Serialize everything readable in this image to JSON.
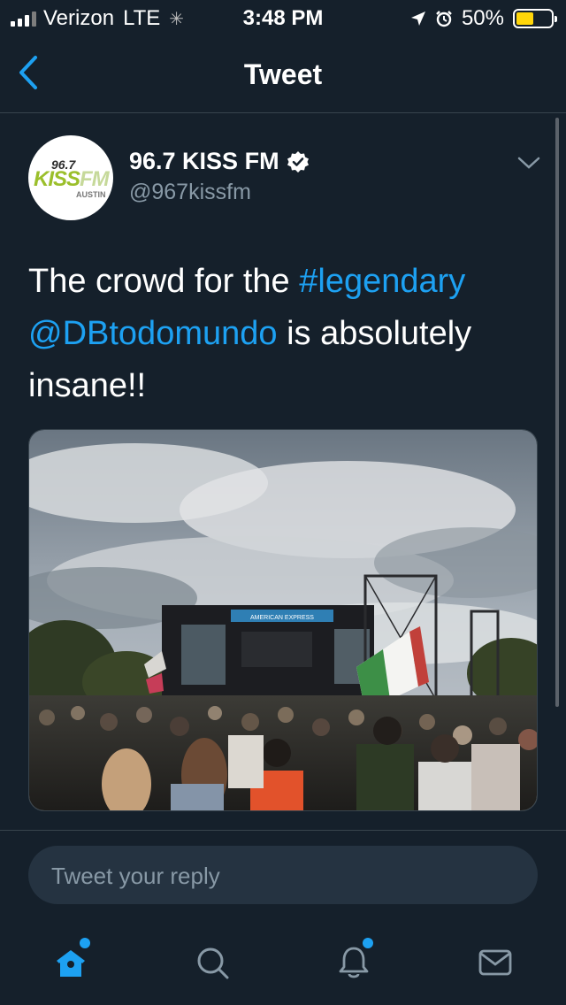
{
  "status_bar": {
    "carrier": "Verizon",
    "network": "LTE",
    "time": "3:48 PM",
    "battery_text": "50%",
    "battery_level": 0.5
  },
  "header": {
    "title": "Tweet",
    "back_icon": "chevron-left-icon"
  },
  "tweet": {
    "author": {
      "name": "96.7 KISS FM",
      "handle": "@967kissfm",
      "verified": true,
      "avatar_logo": {
        "top": "96.7",
        "main_kiss": "KISS",
        "main_fm": "FM",
        "bottom": "AUSTIN"
      }
    },
    "text_parts": {
      "t1": "The crowd for the ",
      "hashtag": "#legendary",
      "mention": "@DBtodomundo",
      "t2": " is absolutely insane!!"
    },
    "image": {
      "stage_banner": "AMERICAN EXPRESS"
    }
  },
  "reply": {
    "placeholder": "Tweet your reply"
  },
  "tab_bar": {
    "items": [
      {
        "name": "home",
        "icon": "home-icon",
        "active": true,
        "has_dot": true
      },
      {
        "name": "search",
        "icon": "search-icon",
        "active": false,
        "has_dot": false
      },
      {
        "name": "notifications",
        "icon": "bell-icon",
        "active": false,
        "has_dot": true
      },
      {
        "name": "messages",
        "icon": "mail-icon",
        "active": false,
        "has_dot": false
      }
    ]
  },
  "colors": {
    "background": "#15202b",
    "accent": "#1da1f2",
    "secondary_text": "#8899a6",
    "divider": "#38444d"
  }
}
